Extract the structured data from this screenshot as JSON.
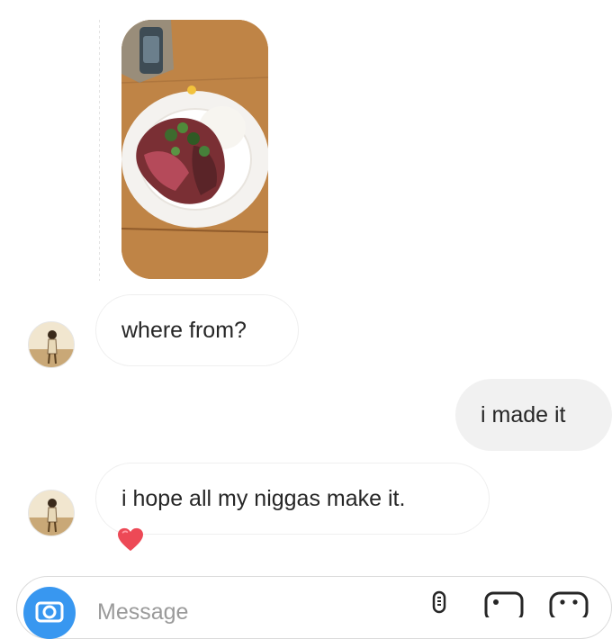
{
  "thread": {
    "photo": {
      "icon": "shared-photo-steak-rice"
    },
    "messages": [
      {
        "sender": "them",
        "text": "where from?"
      },
      {
        "sender": "me",
        "text": "i made it"
      },
      {
        "sender": "them",
        "text": "i hope all my niggas make it.",
        "reaction": "heart"
      }
    ]
  },
  "composer": {
    "placeholder": "Message",
    "icons": [
      "camera-icon",
      "microphone-icon",
      "gallery-icon",
      "sticker-icon"
    ],
    "accent": "#3897f0"
  }
}
